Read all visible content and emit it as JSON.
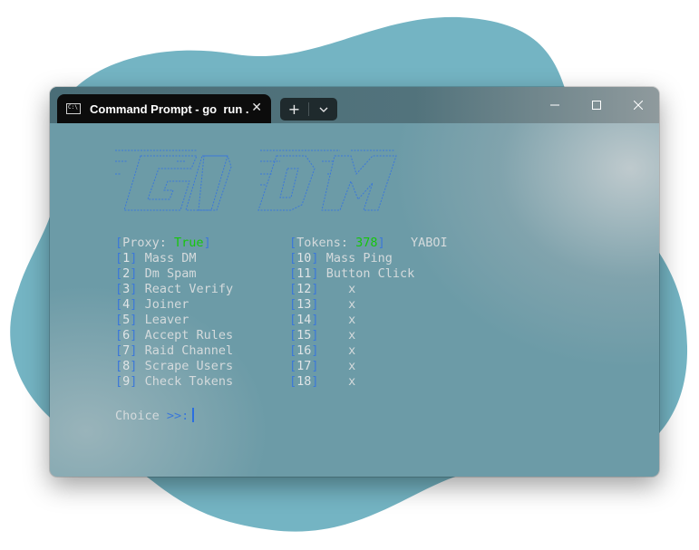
{
  "window": {
    "tab_title": "Command Prompt - go  run .",
    "tab_icon": "cmd-icon",
    "new_tab": "+",
    "dropdown_icon": "chevron-down-icon",
    "controls": [
      "minimize-icon",
      "maximize-icon",
      "close-icon"
    ]
  },
  "banner": {
    "text": "GO DM",
    "color": "#3c78d8"
  },
  "status": {
    "proxy_label": "Proxy: ",
    "proxy_value": "True",
    "tokens_label": "Tokens: ",
    "tokens_value": "378",
    "tag": "YABOI"
  },
  "menu_left": [
    {
      "num": "1",
      "label": "Mass DM"
    },
    {
      "num": "2",
      "label": "Dm Spam"
    },
    {
      "num": "3",
      "label": "React Verify"
    },
    {
      "num": "4",
      "label": "Joiner"
    },
    {
      "num": "5",
      "label": "Leaver"
    },
    {
      "num": "6",
      "label": "Accept Rules"
    },
    {
      "num": "7",
      "label": "Raid Channel"
    },
    {
      "num": "8",
      "label": "Scrape Users"
    },
    {
      "num": "9",
      "label": "Check Tokens"
    }
  ],
  "menu_right": [
    {
      "num": "10",
      "label": "Mass Ping"
    },
    {
      "num": "11",
      "label": "Button Click"
    },
    {
      "num": "12",
      "label": "x"
    },
    {
      "num": "13",
      "label": "x"
    },
    {
      "num": "14",
      "label": "x"
    },
    {
      "num": "15",
      "label": "x"
    },
    {
      "num": "16",
      "label": "x"
    },
    {
      "num": "17",
      "label": "x"
    },
    {
      "num": "18",
      "label": "x"
    }
  ],
  "prompt": {
    "label": "Choice",
    "symbol": ">>:"
  },
  "colors": {
    "accent_blue": "#3c78d8",
    "green": "#16c60c",
    "blob": "#6fb3c3"
  }
}
